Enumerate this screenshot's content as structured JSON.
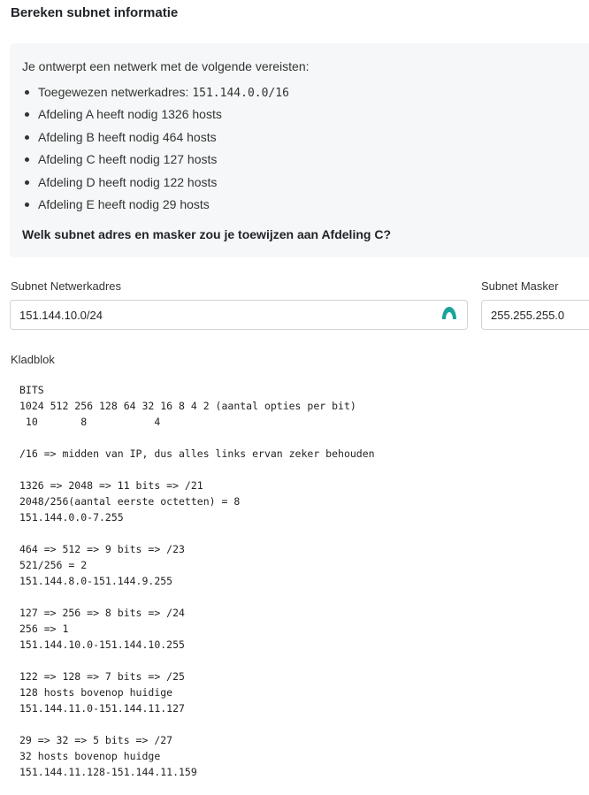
{
  "page": {
    "title": "Bereken subnet informatie"
  },
  "question": {
    "intro": "Je ontwerpt een netwerk met de volgende vereisten:",
    "requirements": [
      {
        "text": "Toegewezen netwerkadres: ",
        "code": "151.144.0.0/16"
      },
      {
        "text": "Afdeling A heeft nodig 1326 hosts"
      },
      {
        "text": "Afdeling B heeft nodig 464 hosts"
      },
      {
        "text": "Afdeling C heeft nodig 127 hosts"
      },
      {
        "text": "Afdeling D heeft nodig 122 hosts"
      },
      {
        "text": "Afdeling E heeft nodig 29 hosts"
      }
    ],
    "prompt": "Welk subnet adres en masker zou je toewijzen aan Afdeling C?"
  },
  "form": {
    "network_label": "Subnet Netwerkadres",
    "network_value": "151.144.10.0/24",
    "mask_label": "Subnet Masker",
    "mask_value": "255.255.255.0",
    "scratch_label": "Kladblok",
    "scratch_text": "BITS\n1024 512 256 128 64 32 16 8 4 2 (aantal opties per bit)\n 10       8           4\n\n/16 => midden van IP, dus alles links ervan zeker behouden\n\n1326 => 2048 => 11 bits => /21\n2048/256(aantal eerste octetten) = 8\n151.144.0.0-7.255\n\n464 => 512 => 9 bits => /23\n521/256 = 2\n151.144.8.0-151.144.9.255\n\n127 => 256 => 8 bits => /24\n256 => 1\n151.144.10.0-151.144.10.255\n\n122 => 128 => 7 bits => /25\n128 hosts bovenop huidige\n151.144.11.0-151.144.11.127\n\n29 => 32 => 5 bits => /27\n32 hosts bovenop huidge\n151.144.11.128-151.144.11.159"
  },
  "colors": {
    "accent": "#1aa39a",
    "panel_bg": "#f6f7f8",
    "border": "#d0d4d9"
  },
  "icons": {
    "password_manager": "password-manager-icon"
  }
}
